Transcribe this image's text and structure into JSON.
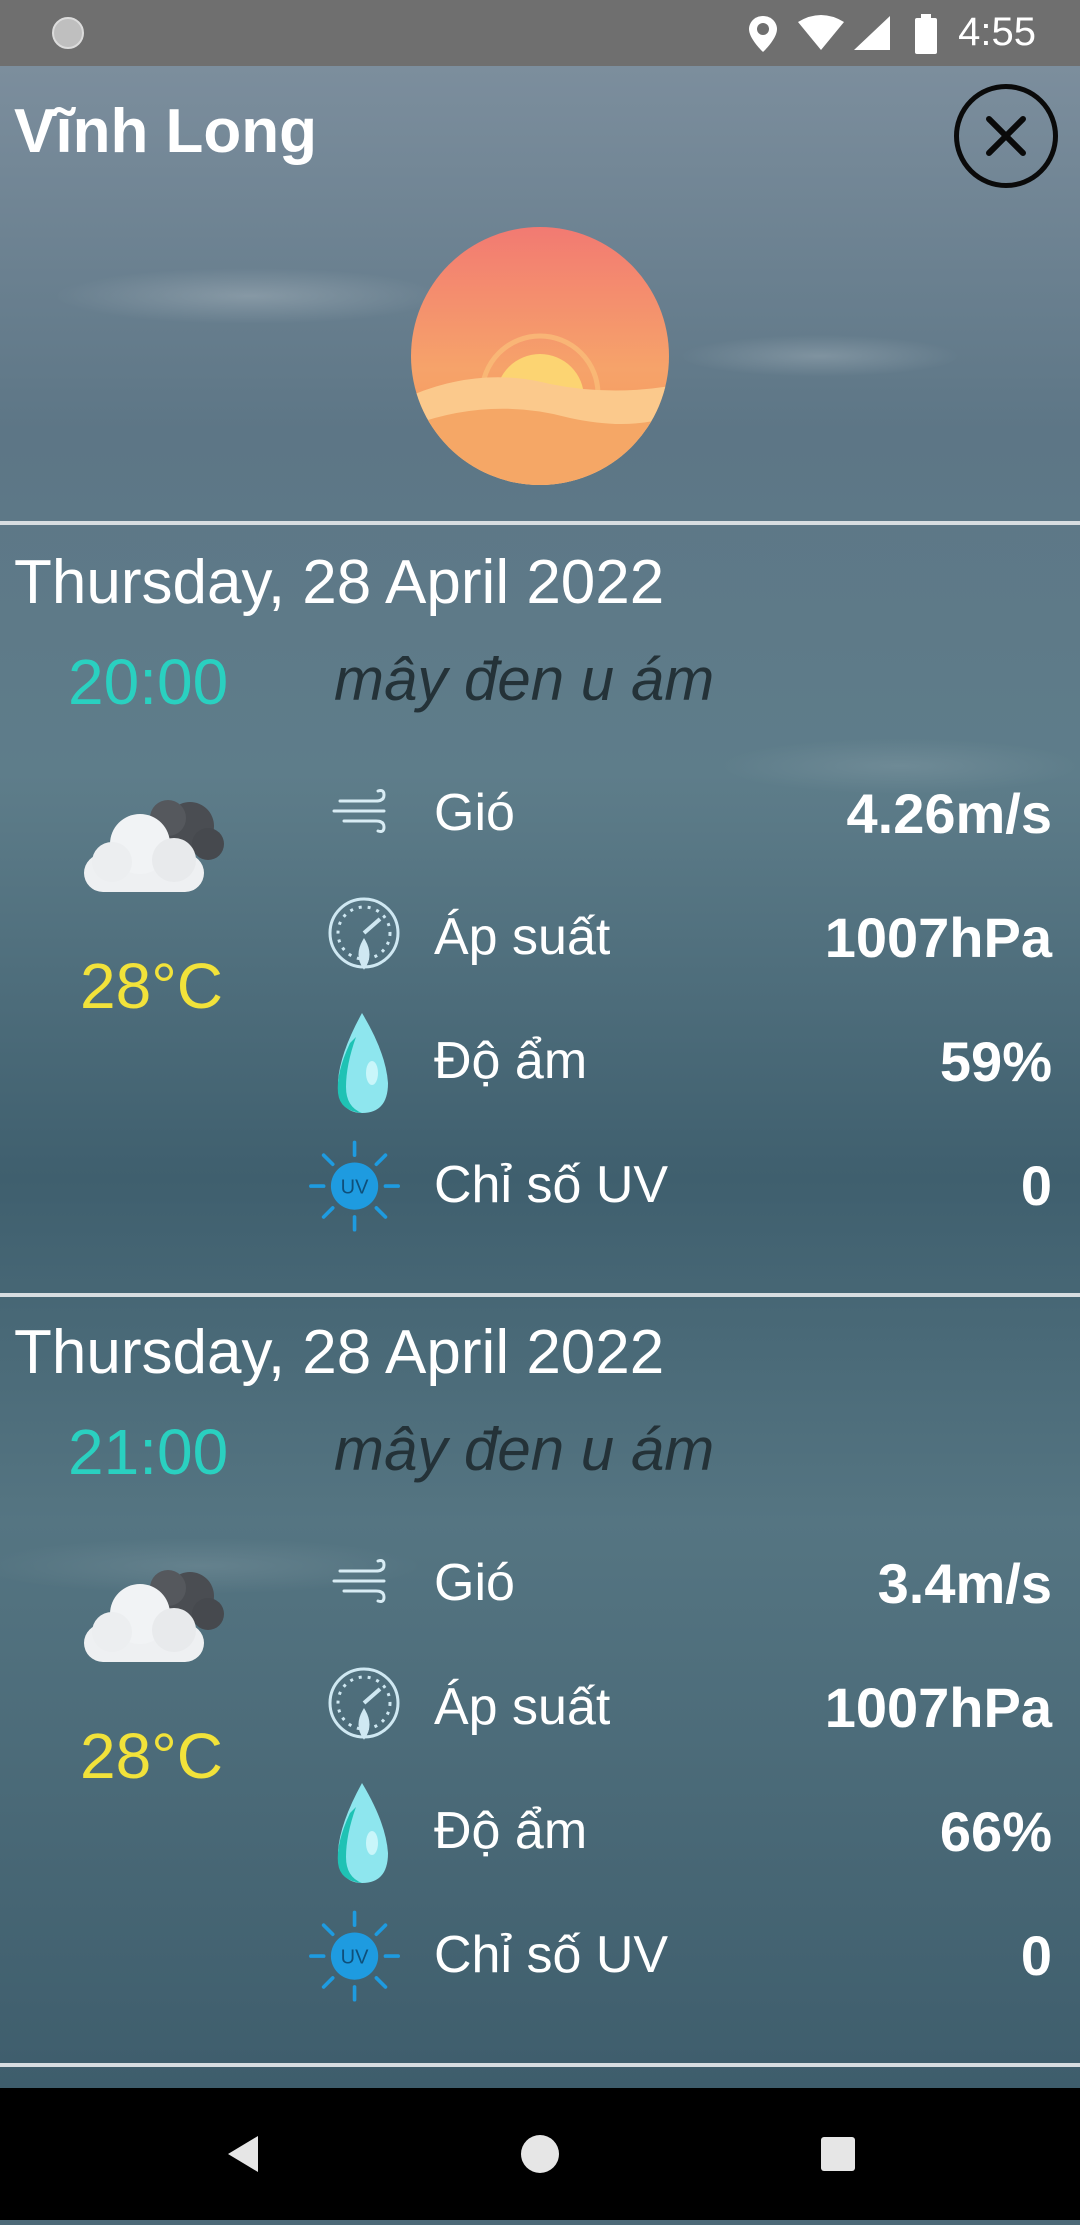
{
  "status_bar": {
    "time": "4:55",
    "icons": [
      "location-icon",
      "wifi-icon",
      "cell-signal-icon",
      "battery-icon"
    ]
  },
  "header": {
    "city": "Vĩnh Long",
    "close_icon": "close-icon",
    "weather_icon": "sunset-icon"
  },
  "labels": {
    "wind": "Gió",
    "pressure": "Áp suất",
    "humidity": "Độ ẩm",
    "uv": "Chỉ số UV"
  },
  "forecasts": [
    {
      "date": "Thursday, 28 April 2022",
      "time": "20:00",
      "description": "mây đen u ám",
      "temperature": "28°C",
      "icon": "dark-cloud-icon",
      "wind": "4.26m/s",
      "pressure": "1007hPa",
      "humidity": "59%",
      "uv": "0"
    },
    {
      "date": "Thursday, 28 April 2022",
      "time": "21:00",
      "description": "mây đen u ám",
      "temperature": "28°C",
      "icon": "dark-cloud-icon",
      "wind": "3.4m/s",
      "pressure": "1007hPa",
      "humidity": "66%",
      "uv": "0"
    }
  ],
  "colors": {
    "time": "#2ad0c0",
    "temperature": "#f2e23a",
    "description": "#243238",
    "uv_icon": "#1e9be0"
  },
  "nav_bar": {
    "icons": [
      "back-icon",
      "home-icon",
      "recents-icon"
    ]
  }
}
